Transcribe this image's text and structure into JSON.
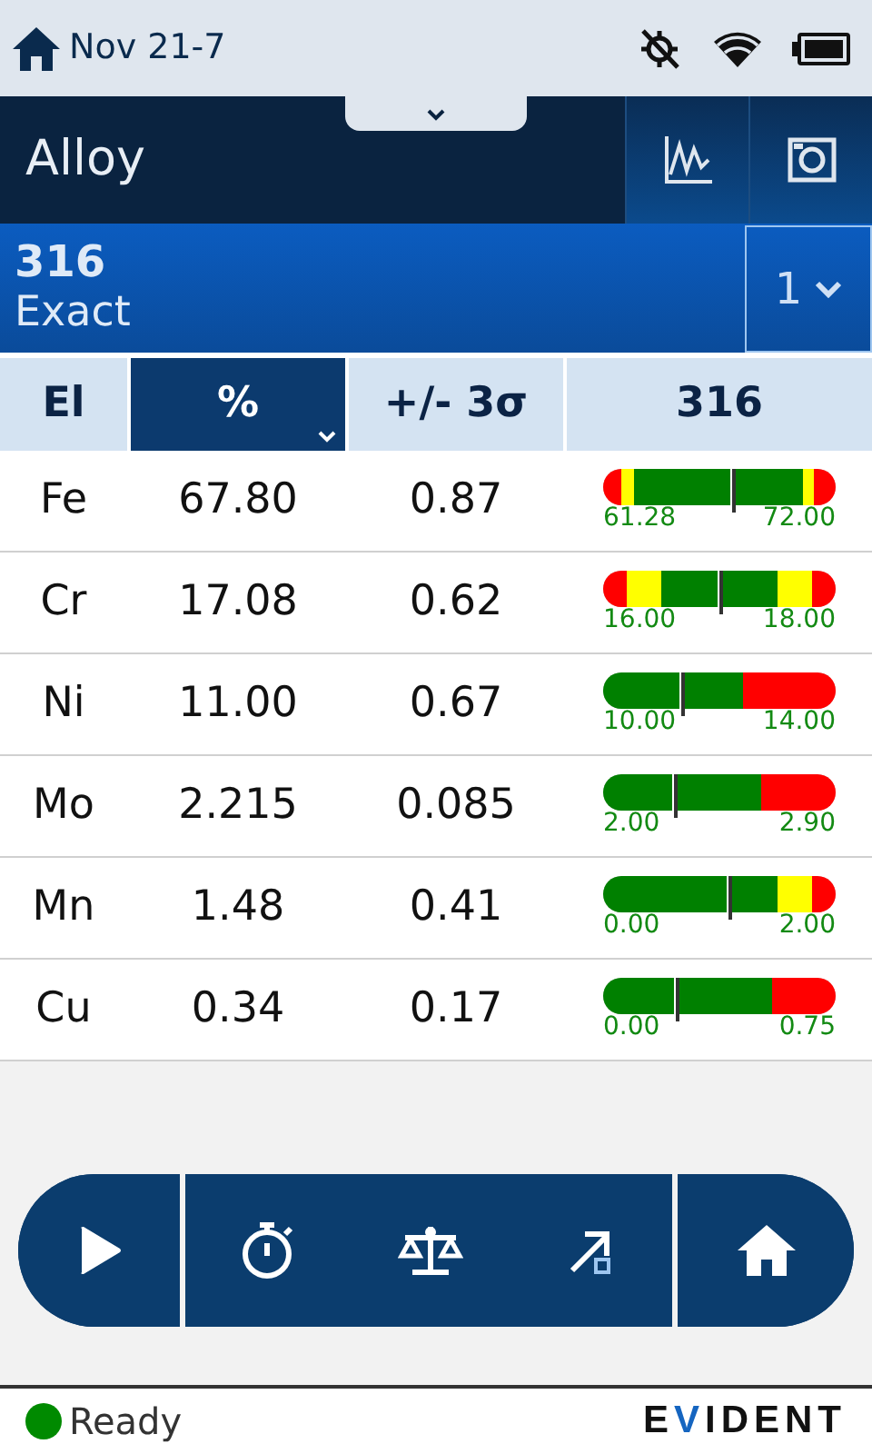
{
  "status_bar": {
    "title": "Nov 21-7"
  },
  "header": {
    "title": "Alloy"
  },
  "match": {
    "grade": "316",
    "quality": "Exact",
    "rank": "1"
  },
  "table": {
    "columns": [
      {
        "label": "El",
        "selected": false
      },
      {
        "label": "%",
        "selected": true
      },
      {
        "label": "+/- 3σ",
        "selected": false
      },
      {
        "label": "316",
        "selected": false
      }
    ],
    "rows": [
      {
        "element": "Fe",
        "percent": "67.80",
        "error": "0.87",
        "range": {
          "low": "61.28",
          "high": "72.00",
          "level": 0.56,
          "segments": [
            {
              "color": "#ff0000"
            },
            {
              "color": "#ffff00"
            },
            {
              "color": "#008000"
            },
            {
              "color": "#ffff00"
            },
            {
              "color": "#ff0000"
            }
          ]
        }
      },
      {
        "element": "Cr",
        "percent": "17.08",
        "error": "0.62",
        "range": {
          "low": "16.00",
          "high": "18.00",
          "level": 0.51,
          "segments": [
            {
              "color": "#ff0000"
            },
            {
              "color": "#ffff00"
            },
            {
              "color": "#008000"
            },
            {
              "color": "#ffff00"
            },
            {
              "color": "#ff0000"
            }
          ]
        }
      },
      {
        "element": "Ni",
        "percent": "11.00",
        "error": "0.67",
        "range": {
          "low": "10.00",
          "high": "14.00",
          "level": 0.34,
          "segments": [
            {
              "color": "#008000"
            },
            {
              "color": "#ff0000"
            }
          ]
        }
      },
      {
        "element": "Mo",
        "percent": "2.215",
        "error": "0.085",
        "range": {
          "low": "2.00",
          "high": "2.90",
          "level": 0.31,
          "segments": [
            {
              "color": "#008000"
            },
            {
              "color": "#ff0000"
            }
          ]
        }
      },
      {
        "element": "Mn",
        "percent": "1.48",
        "error": "0.41",
        "range": {
          "low": "0.00",
          "high": "2.00",
          "level": 0.55,
          "segments": [
            {
              "color": "#008000"
            },
            {
              "color": "#ffff00"
            },
            {
              "color": "#ff0000"
            }
          ]
        }
      },
      {
        "element": "Cu",
        "percent": "0.34",
        "error": "0.17",
        "range": {
          "low": "0.00",
          "high": "0.75",
          "level": 0.32,
          "segments": [
            {
              "color": "#008000"
            },
            {
              "color": "#ff0000"
            }
          ]
        }
      }
    ]
  },
  "footer": {
    "status": {
      "label": "Ready",
      "color": "#008a00"
    },
    "logo": "EVIDENT"
  }
}
